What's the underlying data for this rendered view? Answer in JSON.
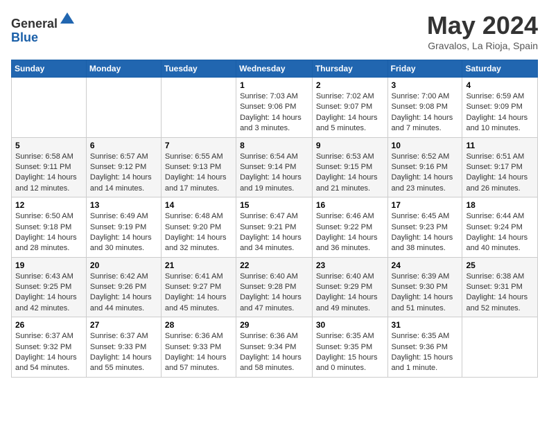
{
  "header": {
    "logo_line1": "General",
    "logo_line2": "Blue",
    "month_title": "May 2024",
    "location": "Gravalos, La Rioja, Spain"
  },
  "days_of_week": [
    "Sunday",
    "Monday",
    "Tuesday",
    "Wednesday",
    "Thursday",
    "Friday",
    "Saturday"
  ],
  "weeks": [
    [
      {
        "day": "",
        "info": ""
      },
      {
        "day": "",
        "info": ""
      },
      {
        "day": "",
        "info": ""
      },
      {
        "day": "1",
        "info": "Sunrise: 7:03 AM\nSunset: 9:06 PM\nDaylight: 14 hours and 3 minutes."
      },
      {
        "day": "2",
        "info": "Sunrise: 7:02 AM\nSunset: 9:07 PM\nDaylight: 14 hours and 5 minutes."
      },
      {
        "day": "3",
        "info": "Sunrise: 7:00 AM\nSunset: 9:08 PM\nDaylight: 14 hours and 7 minutes."
      },
      {
        "day": "4",
        "info": "Sunrise: 6:59 AM\nSunset: 9:09 PM\nDaylight: 14 hours and 10 minutes."
      }
    ],
    [
      {
        "day": "5",
        "info": "Sunrise: 6:58 AM\nSunset: 9:11 PM\nDaylight: 14 hours and 12 minutes."
      },
      {
        "day": "6",
        "info": "Sunrise: 6:57 AM\nSunset: 9:12 PM\nDaylight: 14 hours and 14 minutes."
      },
      {
        "day": "7",
        "info": "Sunrise: 6:55 AM\nSunset: 9:13 PM\nDaylight: 14 hours and 17 minutes."
      },
      {
        "day": "8",
        "info": "Sunrise: 6:54 AM\nSunset: 9:14 PM\nDaylight: 14 hours and 19 minutes."
      },
      {
        "day": "9",
        "info": "Sunrise: 6:53 AM\nSunset: 9:15 PM\nDaylight: 14 hours and 21 minutes."
      },
      {
        "day": "10",
        "info": "Sunrise: 6:52 AM\nSunset: 9:16 PM\nDaylight: 14 hours and 23 minutes."
      },
      {
        "day": "11",
        "info": "Sunrise: 6:51 AM\nSunset: 9:17 PM\nDaylight: 14 hours and 26 minutes."
      }
    ],
    [
      {
        "day": "12",
        "info": "Sunrise: 6:50 AM\nSunset: 9:18 PM\nDaylight: 14 hours and 28 minutes."
      },
      {
        "day": "13",
        "info": "Sunrise: 6:49 AM\nSunset: 9:19 PM\nDaylight: 14 hours and 30 minutes."
      },
      {
        "day": "14",
        "info": "Sunrise: 6:48 AM\nSunset: 9:20 PM\nDaylight: 14 hours and 32 minutes."
      },
      {
        "day": "15",
        "info": "Sunrise: 6:47 AM\nSunset: 9:21 PM\nDaylight: 14 hours and 34 minutes."
      },
      {
        "day": "16",
        "info": "Sunrise: 6:46 AM\nSunset: 9:22 PM\nDaylight: 14 hours and 36 minutes."
      },
      {
        "day": "17",
        "info": "Sunrise: 6:45 AM\nSunset: 9:23 PM\nDaylight: 14 hours and 38 minutes."
      },
      {
        "day": "18",
        "info": "Sunrise: 6:44 AM\nSunset: 9:24 PM\nDaylight: 14 hours and 40 minutes."
      }
    ],
    [
      {
        "day": "19",
        "info": "Sunrise: 6:43 AM\nSunset: 9:25 PM\nDaylight: 14 hours and 42 minutes."
      },
      {
        "day": "20",
        "info": "Sunrise: 6:42 AM\nSunset: 9:26 PM\nDaylight: 14 hours and 44 minutes."
      },
      {
        "day": "21",
        "info": "Sunrise: 6:41 AM\nSunset: 9:27 PM\nDaylight: 14 hours and 45 minutes."
      },
      {
        "day": "22",
        "info": "Sunrise: 6:40 AM\nSunset: 9:28 PM\nDaylight: 14 hours and 47 minutes."
      },
      {
        "day": "23",
        "info": "Sunrise: 6:40 AM\nSunset: 9:29 PM\nDaylight: 14 hours and 49 minutes."
      },
      {
        "day": "24",
        "info": "Sunrise: 6:39 AM\nSunset: 9:30 PM\nDaylight: 14 hours and 51 minutes."
      },
      {
        "day": "25",
        "info": "Sunrise: 6:38 AM\nSunset: 9:31 PM\nDaylight: 14 hours and 52 minutes."
      }
    ],
    [
      {
        "day": "26",
        "info": "Sunrise: 6:37 AM\nSunset: 9:32 PM\nDaylight: 14 hours and 54 minutes."
      },
      {
        "day": "27",
        "info": "Sunrise: 6:37 AM\nSunset: 9:33 PM\nDaylight: 14 hours and 55 minutes."
      },
      {
        "day": "28",
        "info": "Sunrise: 6:36 AM\nSunset: 9:33 PM\nDaylight: 14 hours and 57 minutes."
      },
      {
        "day": "29",
        "info": "Sunrise: 6:36 AM\nSunset: 9:34 PM\nDaylight: 14 hours and 58 minutes."
      },
      {
        "day": "30",
        "info": "Sunrise: 6:35 AM\nSunset: 9:35 PM\nDaylight: 15 hours and 0 minutes."
      },
      {
        "day": "31",
        "info": "Sunrise: 6:35 AM\nSunset: 9:36 PM\nDaylight: 15 hours and 1 minute."
      },
      {
        "day": "",
        "info": ""
      }
    ]
  ]
}
